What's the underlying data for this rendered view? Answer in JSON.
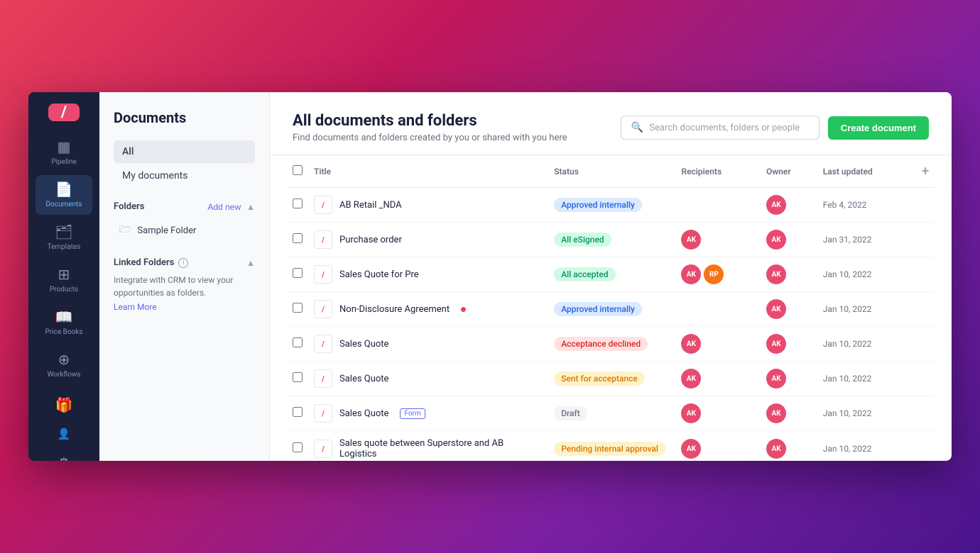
{
  "app": {
    "logo": "/",
    "title": "Documents"
  },
  "sidebar": {
    "items": [
      {
        "id": "pipeline",
        "label": "Pipeline",
        "icon": "▦",
        "active": false
      },
      {
        "id": "documents",
        "label": "Documents",
        "icon": "📄",
        "active": true
      },
      {
        "id": "templates",
        "label": "Templates",
        "icon": "🗂",
        "active": false
      },
      {
        "id": "products",
        "label": "Products",
        "icon": "⊞",
        "active": false
      },
      {
        "id": "price-books",
        "label": "Price Books",
        "icon": "📖",
        "active": false
      },
      {
        "id": "workflows",
        "label": "Workflows",
        "icon": "⊕",
        "active": false
      },
      {
        "id": "gifts",
        "label": "Gifts",
        "icon": "🎁",
        "active": false
      },
      {
        "id": "add-user",
        "label": "",
        "icon": "👤+",
        "active": false
      },
      {
        "id": "settings",
        "label": "",
        "icon": "⚙",
        "active": false
      }
    ]
  },
  "left_panel": {
    "title": "Documents",
    "nav": [
      {
        "id": "all",
        "label": "All",
        "active": true
      },
      {
        "id": "my-documents",
        "label": "My documents",
        "active": false
      }
    ],
    "folders_section": {
      "title": "Folders",
      "add_new": "Add new",
      "items": [
        {
          "id": "sample-folder",
          "label": "Sample Folder"
        }
      ]
    },
    "linked_folders": {
      "title": "Linked Folders",
      "description": "Integrate with CRM to view your opportunities as folders.",
      "learn_more": "Learn More"
    }
  },
  "main": {
    "title": "All documents and folders",
    "subtitle": "Find documents and folders created by you or shared with you here",
    "search_placeholder": "Search documents, folders or people",
    "create_button": "Create document",
    "table": {
      "columns": [
        "Title",
        "Status",
        "Recipients",
        "Owner",
        "Last updated"
      ],
      "rows": [
        {
          "id": 1,
          "title": "AB Retail _NDA",
          "has_dot": false,
          "has_form": false,
          "status": "Approved internally",
          "status_type": "approved",
          "recipients": [],
          "owner": "AK",
          "updated": "Feb 4, 2022"
        },
        {
          "id": 2,
          "title": "Purchase order",
          "has_dot": false,
          "has_form": false,
          "status": "All eSigned",
          "status_type": "esigned",
          "recipients": [
            "AK"
          ],
          "owner": "AK",
          "updated": "Jan 31, 2022"
        },
        {
          "id": 3,
          "title": "Sales Quote for Pre",
          "has_dot": false,
          "has_form": false,
          "status": "All accepted",
          "status_type": "accepted",
          "recipients": [
            "AK",
            "RP"
          ],
          "owner": "AK",
          "updated": "Jan 10, 2022"
        },
        {
          "id": 4,
          "title": "Non-Disclosure Agreement",
          "has_dot": true,
          "has_form": false,
          "status": "Approved internally",
          "status_type": "approved",
          "recipients": [],
          "owner": "AK",
          "updated": "Jan 10, 2022"
        },
        {
          "id": 5,
          "title": "Sales Quote",
          "has_dot": false,
          "has_form": false,
          "status": "Acceptance declined",
          "status_type": "declined",
          "recipients": [
            "AK"
          ],
          "owner": "AK",
          "updated": "Jan 10, 2022"
        },
        {
          "id": 6,
          "title": "Sales Quote",
          "has_dot": false,
          "has_form": false,
          "status": "Sent for acceptance",
          "status_type": "sent",
          "recipients": [
            "AK"
          ],
          "owner": "AK",
          "updated": "Jan 10, 2022"
        },
        {
          "id": 7,
          "title": "Sales Quote",
          "has_dot": false,
          "has_form": true,
          "status": "Draft",
          "status_type": "draft",
          "recipients": [
            "AK"
          ],
          "owner": "AK",
          "updated": "Jan 10, 2022"
        },
        {
          "id": 8,
          "title": "Sales quote between Superstore and AB Logistics",
          "has_dot": false,
          "has_form": false,
          "status": "Pending internal approval",
          "status_type": "pending",
          "recipients": [
            "AK"
          ],
          "owner": "AK",
          "updated": "Jan 10, 2022"
        }
      ]
    }
  },
  "colors": {
    "brand": "#e84a6f",
    "accent": "#6366f1",
    "success": "#22c55e",
    "sidebar_bg": "#1a1f3a"
  }
}
